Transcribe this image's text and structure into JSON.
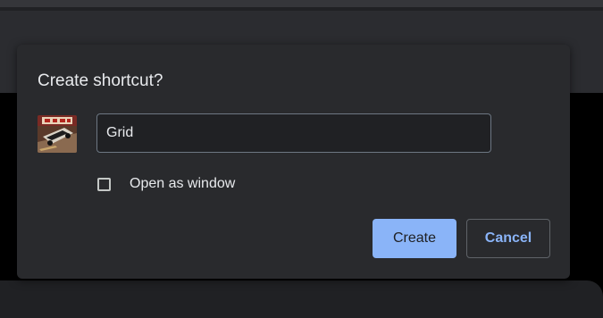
{
  "dialog": {
    "title": "Create shortcut?",
    "name_input": {
      "value": "Grid",
      "placeholder": ""
    },
    "open_as_window": {
      "label": "Open as window",
      "checked": false
    },
    "buttons": {
      "create": "Create",
      "cancel": "Cancel"
    },
    "app_icon": "grid-game-icon"
  },
  "colors": {
    "accent": "#8ab4f8",
    "dialog_background": "#292a2d",
    "text": "#e8eaed"
  }
}
